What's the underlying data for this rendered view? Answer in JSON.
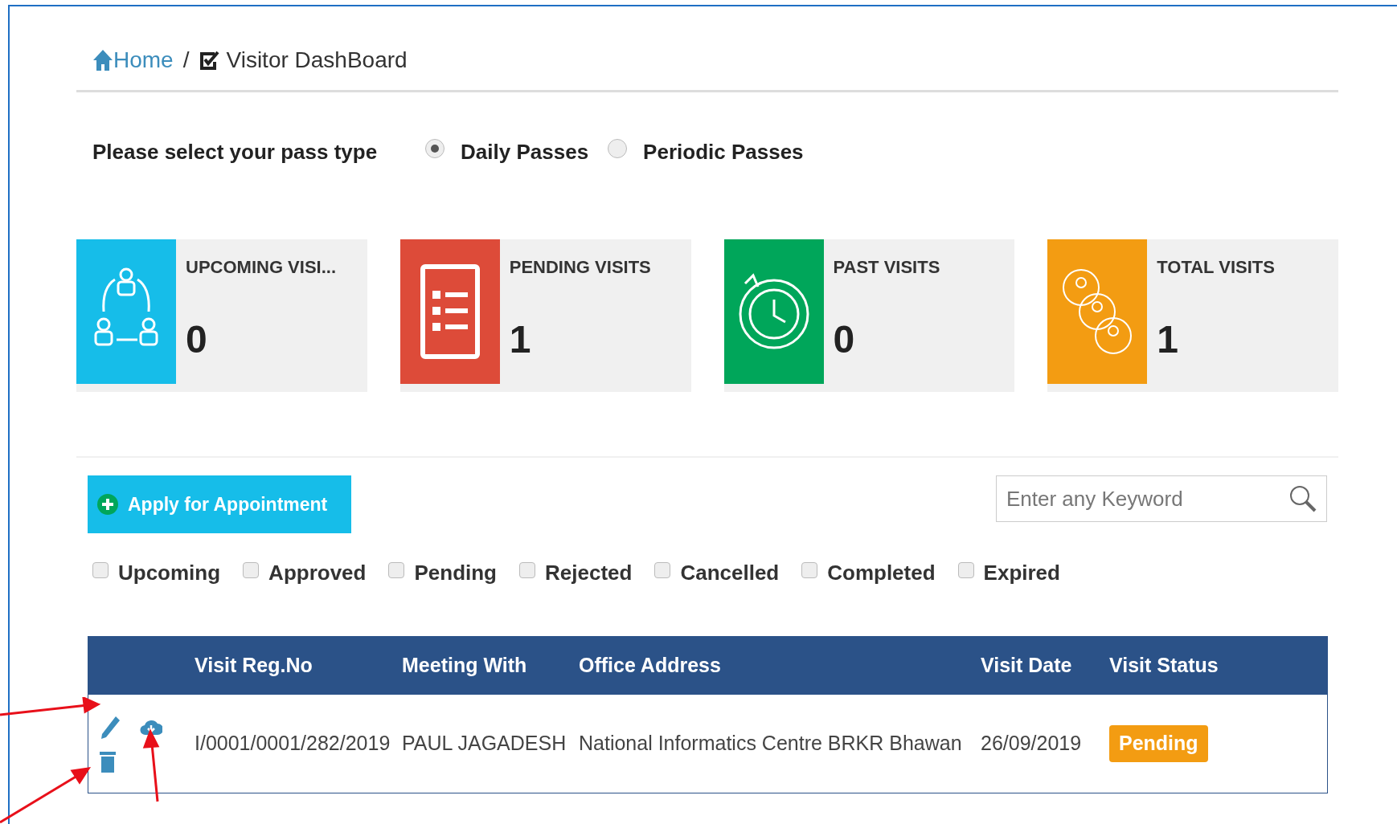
{
  "breadcrumb": {
    "items": [
      {
        "label": "Home",
        "kind": "link"
      },
      {
        "label": "Visitor DashBoard",
        "kind": "current"
      }
    ],
    "separator": "/"
  },
  "pass_type": {
    "label": "Please select your pass type",
    "options": [
      {
        "label": "Daily Passes",
        "selected": true
      },
      {
        "label": "Periodic Passes",
        "selected": false
      }
    ]
  },
  "cards": [
    {
      "kind": "upcoming",
      "title": "UPCOMING VISI...",
      "value": "0",
      "color": "#16bde9"
    },
    {
      "kind": "pending",
      "title": "PENDING VISITS",
      "value": "1",
      "color": "#dd4b39"
    },
    {
      "kind": "past",
      "title": "PAST VISITS",
      "value": "0",
      "color": "#00a65a"
    },
    {
      "kind": "total",
      "title": "TOTAL VISITS",
      "value": "1",
      "color": "#f39c12"
    }
  ],
  "apply_button": {
    "label": "Apply for Appointment"
  },
  "search": {
    "placeholder": "Enter any Keyword"
  },
  "filters": [
    {
      "label": "Upcoming",
      "checked": false
    },
    {
      "label": "Approved",
      "checked": false
    },
    {
      "label": "Pending",
      "checked": false
    },
    {
      "label": "Rejected",
      "checked": false
    },
    {
      "label": "Cancelled",
      "checked": false
    },
    {
      "label": "Completed",
      "checked": false
    },
    {
      "label": "Expired",
      "checked": false
    }
  ],
  "table": {
    "columns": [
      "Visit Reg.No",
      "Meeting With",
      "Office Address",
      "Visit Date",
      "Visit Status"
    ],
    "rows": [
      {
        "cells": [
          "I/0001/0001/282/2019",
          "PAUL JAGADESH",
          "National Informatics Centre BRKR Bhawan",
          "26/09/2019"
        ],
        "status": "Pending"
      }
    ]
  }
}
